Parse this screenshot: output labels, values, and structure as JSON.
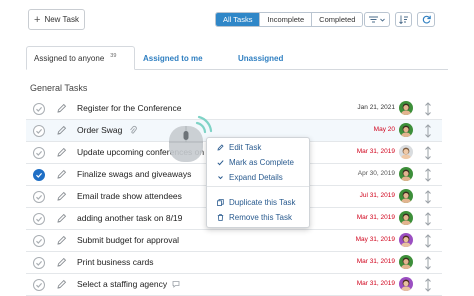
{
  "toolbar": {
    "new_task_label": "New Task",
    "filters": [
      "All Tasks",
      "Incomplete",
      "Completed"
    ]
  },
  "tabs": {
    "assigned_to_anyone": "Assigned to anyone",
    "assigned_count": "39",
    "assigned_to_me": "Assigned to me",
    "unassigned": "Unassigned"
  },
  "section_title": "General Tasks",
  "tasks": [
    {
      "title": "Register for the Conference",
      "date": "Jan 21, 2021",
      "date_color": "#333333",
      "done": false,
      "avatar": "green"
    },
    {
      "title": "Order Swag",
      "date": "May 20",
      "date_color": "#d0021b",
      "done": false,
      "avatar": "green"
    },
    {
      "title": "Update upcoming conferences on",
      "date": "Mar 31, 2019",
      "date_color": "#d0021b",
      "done": false,
      "avatar": "grey"
    },
    {
      "title": "Finalize swags and giveaways",
      "date": "Apr 30, 2019",
      "date_color": "#555555",
      "done": true,
      "avatar": "green"
    },
    {
      "title": "Email trade show attendees",
      "date": "Jul 31, 2019",
      "date_color": "#d0021b",
      "done": false,
      "avatar": "green"
    },
    {
      "title": "adding another task on 8/19",
      "date": "Mar 31, 2019",
      "date_color": "#d0021b",
      "done": false,
      "avatar": "green"
    },
    {
      "title": "Submit budget for approval",
      "date": "May 31, 2019",
      "date_color": "#d0021b",
      "done": false,
      "avatar": "purple"
    },
    {
      "title": "Print business cards",
      "date": "Mar 31, 2019",
      "date_color": "#d0021b",
      "done": false,
      "avatar": "green"
    },
    {
      "title": "Select a staffing agency",
      "date": "Mar 31, 2019",
      "date_color": "#d0021b",
      "done": false,
      "avatar": "purple"
    }
  ],
  "context_menu": {
    "edit": "Edit Task",
    "mark_complete": "Mark as Complete",
    "expand": "Expand Details",
    "duplicate": "Duplicate this Task",
    "remove": "Remove this Task"
  },
  "colors": {
    "accent": "#2f87c8",
    "link": "#2f7fc1",
    "overdue": "#d0021b"
  },
  "icons": {
    "check": "checkmark-circle-icon",
    "edit": "pencil-icon",
    "attachment": "paperclip-icon",
    "comment": "speech-bubble-icon",
    "drag": "vertical-drag-handle-icon",
    "mouse": "mouse-click-icon"
  }
}
